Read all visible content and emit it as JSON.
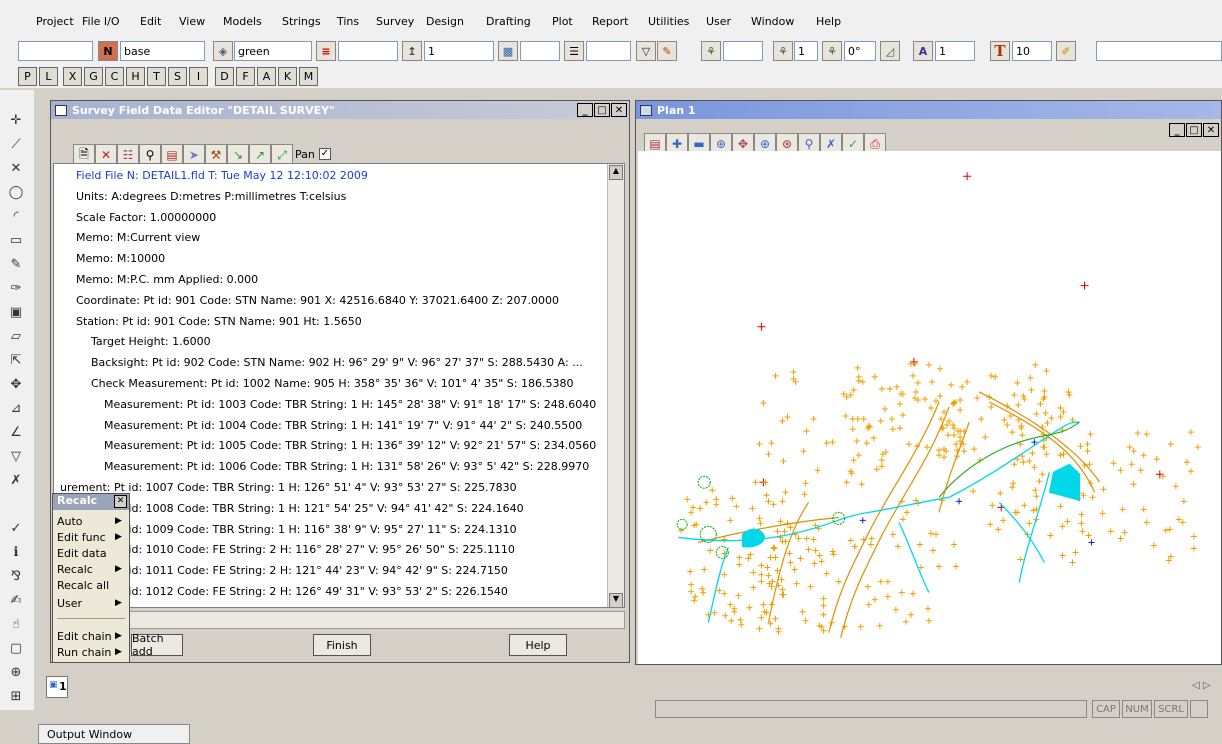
{
  "menu": [
    "Project",
    "File I/O",
    "Edit",
    "View",
    "Models",
    "Strings",
    "Tins",
    "Survey",
    "Design",
    "Drafting",
    "Plot",
    "Report",
    "Utilities",
    "User",
    "Window",
    "Help"
  ],
  "toolbar": {
    "model_value": "base",
    "colour_value": "green",
    "weight_value": "1",
    "text_size_value": "1",
    "angle_value": "0°",
    "font_value": "1",
    "text_height_value": "10",
    "n_label": "N",
    "t_label": "T"
  },
  "letter_buttons": [
    "P",
    "L",
    "X",
    "G",
    "C",
    "H",
    "T",
    "S",
    "I",
    "D",
    "F",
    "A",
    "K",
    "M"
  ],
  "editor": {
    "title": "Survey Field Data Editor \"DETAIL SURVEY\"",
    "pan_label": "Pan",
    "lines": [
      {
        "text": "Field File N: DETAIL1.fld T: Tue May 12 12:10:02 2009",
        "indent": 0,
        "color": "#1a3cd0"
      },
      {
        "text": "Units:  A:degrees D:metres P:millimetres T:celsius",
        "indent": 0
      },
      {
        "text": "Scale Factor:  1.00000000",
        "indent": 0
      },
      {
        "text": "Memo:  M:Current view",
        "indent": 0
      },
      {
        "text": "Memo:  M:10000",
        "indent": 0
      },
      {
        "text": "Memo:  M:P.C. mm Applied: 0.000",
        "indent": 0
      },
      {
        "text": "Coordinate:  Pt id: 901 Code: STN Name: 901 X: 42516.6840 Y: 37021.6400 Z: 207.0000",
        "indent": 0
      },
      {
        "text": "Station:  Pt id: 901 Code: STN Name: 901 Ht:  1.5650",
        "indent": 0
      },
      {
        "text": "Target Height:  1.6000",
        "indent": 1
      },
      {
        "text": "Backsight:  Pt id: 902 Code: STN Name: 902 H:   96° 29'  9\" V:   96° 27' 37\" S: 288.5430 A:  ...",
        "indent": 1
      },
      {
        "text": "Check Measurement:  Pt id: 1002 Name: 905 H:  358° 35' 36\" V:  101°  4' 35\" S: 186.5380",
        "indent": 1
      },
      {
        "text": "Measurement:  Pt id: 1003 Code: TBR String: 1 H:  145° 28' 38\" V:   91° 18' 17\" S: 248.6040",
        "indent": 2
      },
      {
        "text": "Measurement:  Pt id: 1004 Code: TBR String: 1 H:  141° 19'  7\" V:   91° 44'  2\" S: 240.5500",
        "indent": 2
      },
      {
        "text": "Measurement:  Pt id: 1005 Code: TBR String: 1 H:  136° 39' 12\" V:   92° 21' 57\" S: 234.0560",
        "indent": 2
      },
      {
        "text": "Measurement:  Pt id: 1006 Code: TBR String: 1 H:  131° 58' 26\" V:   93°  5' 42\" S: 228.9970",
        "indent": 2
      },
      {
        "text": "urement:  Pt id: 1007 Code: TBR String: 1 H:  126° 51'  4\" V:   93° 53' 27\" S: 225.7830",
        "indent": 3
      },
      {
        "text": "urement:  Pt id: 1008 Code: TBR String: 1 H:  121° 54' 25\" V:   94° 41' 42\" S: 224.1640",
        "indent": 3
      },
      {
        "text": "urement:  Pt id: 1009 Code: TBR String: 1 H:  116° 38'  9\" V:   95° 27' 11\" S: 224.1310",
        "indent": 3
      },
      {
        "text": "urement:  Pt id: 1010 Code: FE String: 2 H:  116° 28' 27\" V:   95° 26' 50\" S: 225.1110",
        "indent": 3
      },
      {
        "text": "urement:  Pt id: 1011 Code: FE String: 2 H:  121° 44' 23\" V:   94° 42'  9\" S: 224.7150",
        "indent": 3
      },
      {
        "text": "urement:  Pt id: 1012 Code: FE String: 2 H:  126° 49' 31\" V:   93° 53'  2\" S: 226.1540",
        "indent": 3
      }
    ],
    "batch_add_label": "Batch add",
    "finish_label": "Finish",
    "help_label": "Help"
  },
  "recalc_menu": {
    "title": "Recalc",
    "items": [
      {
        "label": "Auto",
        "submenu": true
      },
      {
        "label": "Edit func",
        "submenu": true
      },
      {
        "label": "Edit data",
        "submenu": false
      },
      {
        "label": "Recalc",
        "submenu": true
      },
      {
        "label": "Recalc all",
        "submenu": false
      },
      {
        "label": "User",
        "submenu": true
      },
      {
        "label": "Edit chain",
        "submenu": true
      },
      {
        "label": "Run chain",
        "submenu": true
      }
    ]
  },
  "plan": {
    "title": "Plan 1"
  },
  "bottom_tab": {
    "label": "1"
  },
  "status": {
    "cap": "CAP",
    "num": "NUM",
    "scrl": "SCRL"
  },
  "output_tab": "Output Window",
  "colors": {
    "orange": "#f0a000",
    "cyan": "#00e0e0",
    "green": "#00b000",
    "red": "#e00000",
    "blue": "#1020d0",
    "titlebar": "#7a96df"
  }
}
